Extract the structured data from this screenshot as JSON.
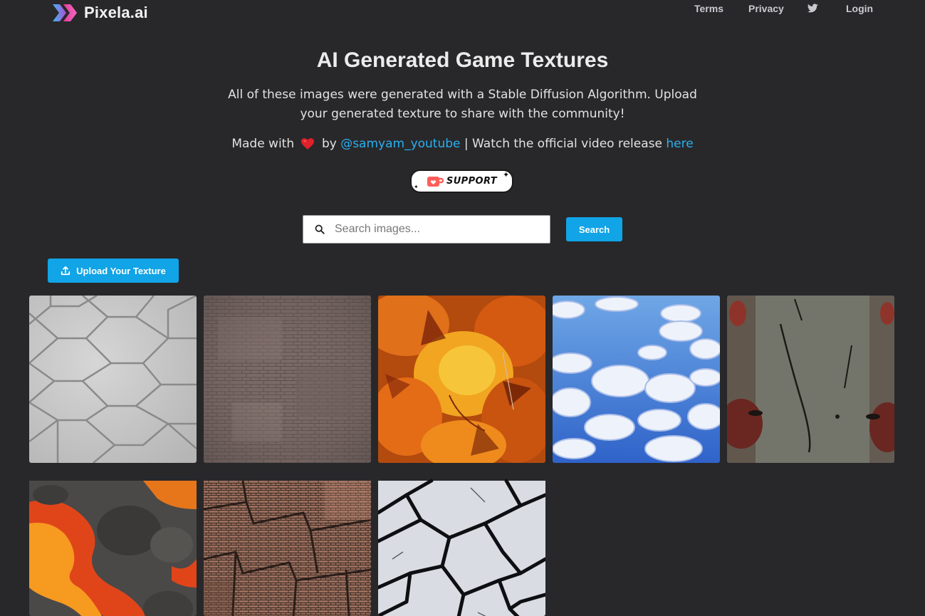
{
  "nav": {
    "brand": "Pixela.ai",
    "links": [
      "Terms",
      "Privacy",
      "Login"
    ],
    "twitter_icon": "twitter-icon"
  },
  "hero": {
    "title": "AI Generated Game Textures",
    "description": "All of these images were generated with a Stable Diffusion Algorithm. Upload your generated texture to share with the community!",
    "made_with_prefix": "Made with",
    "made_with_by": "by",
    "author_link": "@samyam_youtube",
    "video_text": "| Watch the official video release",
    "video_link": "here"
  },
  "support": {
    "label": "SUPPORT"
  },
  "search": {
    "placeholder": "Search images...",
    "button": "Search"
  },
  "upload": {
    "label": "Upload Your Texture"
  },
  "colors": {
    "background": "#28282b",
    "accent": "#11a4e6",
    "link": "#29b0ee",
    "heart": "#e0202a"
  },
  "textures": [
    {
      "subject": "grey-stone-tiles"
    },
    {
      "subject": "worn-brick-wall"
    },
    {
      "subject": "autumn-leaves"
    },
    {
      "subject": "icy-water-floes"
    },
    {
      "subject": "bloody-concrete"
    },
    {
      "subject": "molten-lava-rock"
    },
    {
      "subject": "layered-brick"
    },
    {
      "subject": "cracked-ice"
    }
  ]
}
